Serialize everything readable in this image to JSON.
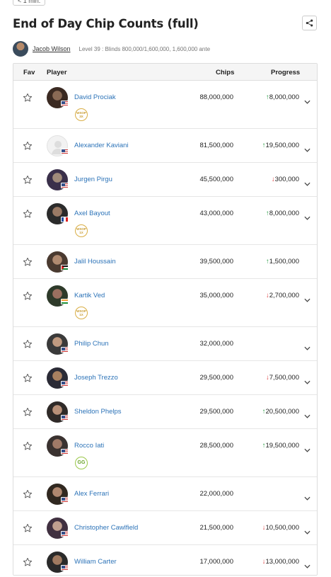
{
  "time_tag": "< 1 min.",
  "title": "End of Day Chip Counts (full)",
  "author": {
    "name": "Jacob Wilson"
  },
  "level_info": "Level 39 : Blinds 800,000/1,600,000, 1,600,000 ante",
  "columns": {
    "fav": "Fav",
    "player": "Player",
    "chips": "Chips",
    "progress": "Progress"
  },
  "colors": {
    "link": "#2c73b8",
    "up": "#2a9d45",
    "down": "#d33",
    "badge_gold": "#d9ae45",
    "badge_green": "#9bc84a"
  },
  "rows": [
    {
      "name": "David Prociak",
      "chips": "88,000,000",
      "progress": "8,000,000",
      "direction": "up",
      "flag": "us",
      "badge": "WSOP 3X",
      "chevron": true
    },
    {
      "name": "Alexander Kaviani",
      "chips": "81,500,000",
      "progress": "19,500,000",
      "direction": "up",
      "flag": "us",
      "badge": "",
      "chevron": true,
      "placeholder_avatar": true
    },
    {
      "name": "Jurgen Pirgu",
      "chips": "45,500,000",
      "progress": "300,000",
      "direction": "down",
      "flag": "us",
      "badge": "",
      "chevron": true
    },
    {
      "name": "Axel Bayout",
      "chips": "43,000,000",
      "progress": "8,000,000",
      "direction": "up",
      "flag": "fr",
      "badge": "WSOP 1X",
      "chevron": true
    },
    {
      "name": "Jalil Houssain",
      "chips": "39,500,000",
      "progress": "1,500,000",
      "direction": "up",
      "flag": "ps",
      "badge": "",
      "chevron": false
    },
    {
      "name": "Kartik Ved",
      "chips": "35,000,000",
      "progress": "2,700,000",
      "direction": "down",
      "flag": "in",
      "badge": "WSOP 1X",
      "chevron": true
    },
    {
      "name": "Philip Chun",
      "chips": "32,000,000",
      "progress": "",
      "direction": "",
      "flag": "us",
      "badge": "",
      "chevron": true
    },
    {
      "name": "Joseph Trezzo",
      "chips": "29,500,000",
      "progress": "7,500,000",
      "direction": "down",
      "flag": "us",
      "badge": "",
      "chevron": true
    },
    {
      "name": "Sheldon Phelps",
      "chips": "29,500,000",
      "progress": "20,500,000",
      "direction": "up",
      "flag": "us",
      "badge": "",
      "chevron": true
    },
    {
      "name": "Rocco Iati",
      "chips": "28,500,000",
      "progress": "19,500,000",
      "direction": "up",
      "flag": "us",
      "badge": "GG",
      "chevron": true
    },
    {
      "name": "Alex Ferrari",
      "chips": "22,000,000",
      "progress": "",
      "direction": "",
      "flag": "us",
      "badge": "",
      "chevron": true
    },
    {
      "name": "Christopher Cawlfield",
      "chips": "21,500,000",
      "progress": "10,500,000",
      "direction": "down",
      "flag": "us",
      "badge": "",
      "chevron": true
    },
    {
      "name": "William Carter",
      "chips": "17,000,000",
      "progress": "13,000,000",
      "direction": "down",
      "flag": "us",
      "badge": "",
      "chevron": true
    }
  ]
}
